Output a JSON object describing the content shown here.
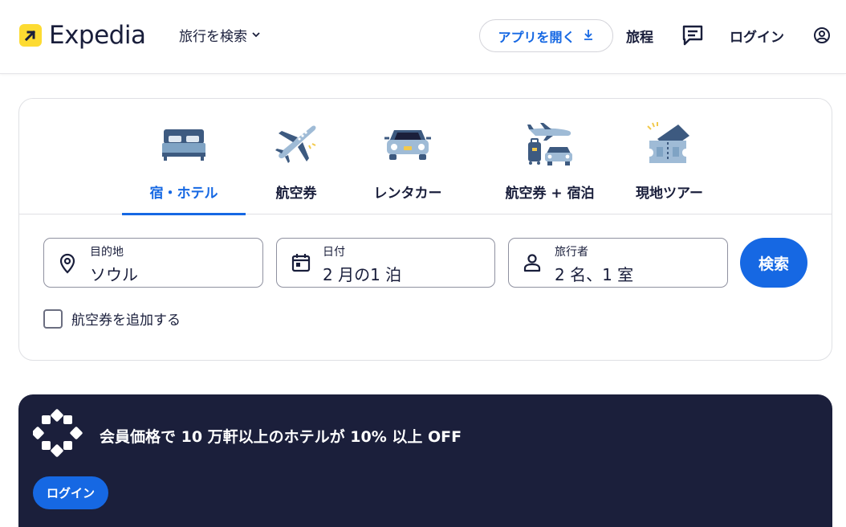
{
  "header": {
    "brand": "Expedia",
    "trip_search_label": "旅行を検索",
    "app_button_label": "アプリを開く",
    "itinerary_label": "旅程",
    "login_label": "ログイン"
  },
  "search": {
    "tabs": [
      {
        "label": "宿・ホテル",
        "icon": "bed-icon",
        "active": true
      },
      {
        "label": "航空券",
        "icon": "airplane-icon",
        "active": false
      },
      {
        "label": "レンタカー",
        "icon": "car-icon",
        "active": false
      },
      {
        "label": "航空券 + 宿泊",
        "icon": "flight-hotel-package-icon",
        "active": false
      },
      {
        "label": "現地ツアー",
        "icon": "ticket-icon",
        "active": false
      }
    ],
    "destination": {
      "label": "目的地",
      "value": "ソウル"
    },
    "dates": {
      "label": "日付",
      "value": "2 月の1 泊"
    },
    "travelers": {
      "label": "旅行者",
      "value": "2 名、1 室"
    },
    "search_button_label": "検索",
    "add_flight_label": "航空券を追加する",
    "add_flight_checked": false
  },
  "promo": {
    "text": "会員価格で 10 万軒以上のホテルが 10% 以上 OFF",
    "login_label": "ログイン",
    "icon": "member-badge-icon"
  },
  "colors": {
    "accent": "#1668e3",
    "brand_yellow": "#fddb32",
    "navy": "#1b1f3b"
  }
}
